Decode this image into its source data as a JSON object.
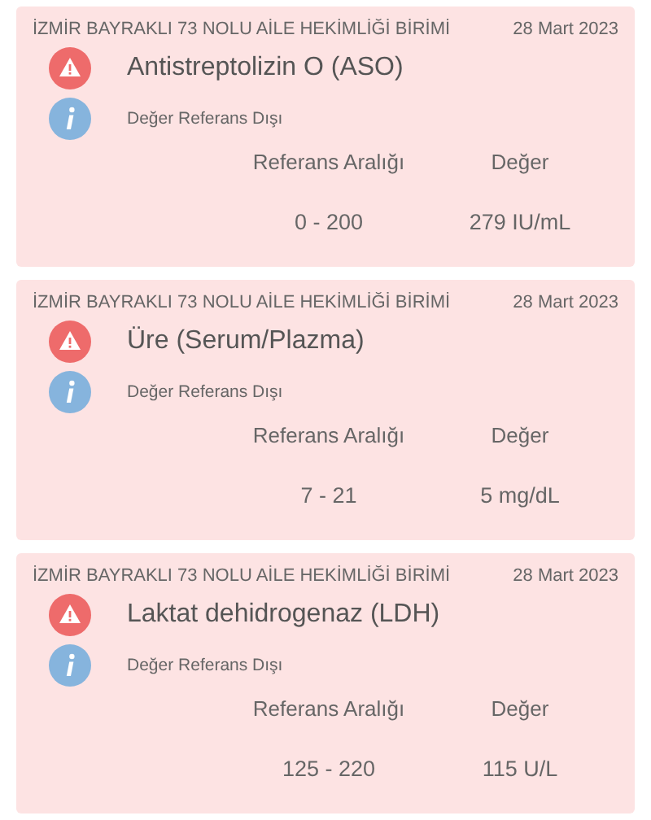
{
  "results": [
    {
      "facility": "İZMİR BAYRAKLI 73 NOLU AİLE HEKİMLİĞİ BİRİMİ",
      "date": "28 Mart 2023",
      "test": "Antistreptolizin O (ASO)",
      "note": "Değer Referans Dışı",
      "range_label": "Referans Aralığı",
      "value_label": "Değer",
      "range": "0 - 200",
      "value": "279 IU/mL"
    },
    {
      "facility": "İZMİR BAYRAKLI 73 NOLU AİLE HEKİMLİĞİ BİRİMİ",
      "date": "28 Mart 2023",
      "test": "Üre (Serum/Plazma)",
      "note": "Değer Referans Dışı",
      "range_label": "Referans Aralığı",
      "value_label": "Değer",
      "range": "7 - 21",
      "value": "5 mg/dL"
    },
    {
      "facility": "İZMİR BAYRAKLI 73 NOLU AİLE HEKİMLİĞİ BİRİMİ",
      "date": "28 Mart 2023",
      "test": "Laktat dehidrogenaz (LDH)",
      "note": "Değer Referans Dışı",
      "range_label": "Referans Aralığı",
      "value_label": "Değer",
      "range": "125 - 220",
      "value": "115 U/L"
    }
  ]
}
